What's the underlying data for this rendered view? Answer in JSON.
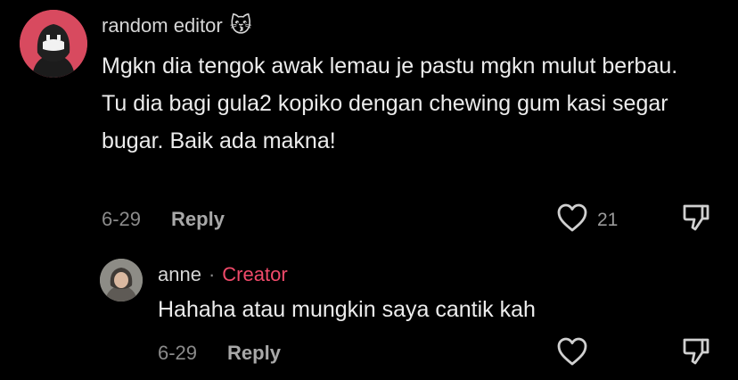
{
  "comment": {
    "username": "random editor",
    "emoji": "😽",
    "text": "Mgkn dia tengok awak lemau je pastu mgkn mulut berbau. Tu dia bagi gula2 kopiko dengan chewing gum kasi segar bugar. Baik ada makna!",
    "date": "6-29",
    "reply_label": "Reply",
    "likes": "21",
    "like_icon": "heart-outline-icon",
    "dislike_icon": "thumbs-down-icon"
  },
  "reply": {
    "username": "anne",
    "separator": "·",
    "badge": "Creator",
    "text": "Hahaha atau mungkin saya cantik kah",
    "date": "6-29",
    "reply_label": "Reply",
    "like_icon": "heart-outline-icon",
    "dislike_icon": "thumbs-down-icon"
  },
  "colors": {
    "background": "#000000",
    "creator_badge": "#f04a6a",
    "avatar_main_bg": "#d84a5f"
  }
}
